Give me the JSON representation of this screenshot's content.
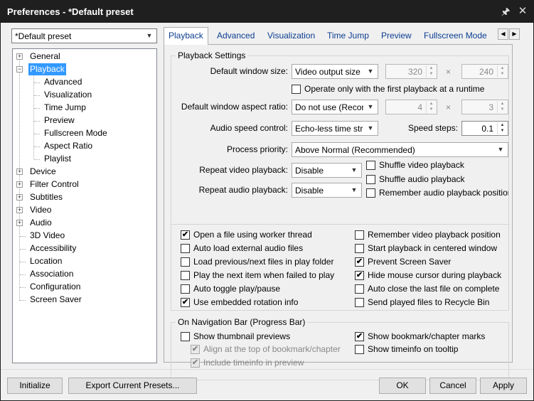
{
  "window": {
    "title": "Preferences - *Default preset",
    "pin_icon": "pin-icon",
    "close_icon": "close-icon"
  },
  "preset_select": {
    "value": "*Default preset"
  },
  "tree": {
    "items": [
      {
        "label": "General"
      },
      {
        "label": "Playback"
      },
      {
        "label": "Advanced"
      },
      {
        "label": "Visualization"
      },
      {
        "label": "Time Jump"
      },
      {
        "label": "Preview"
      },
      {
        "label": "Fullscreen Mode"
      },
      {
        "label": "Aspect Ratio"
      },
      {
        "label": "Playlist"
      },
      {
        "label": "Device"
      },
      {
        "label": "Filter Control"
      },
      {
        "label": "Subtitles"
      },
      {
        "label": "Video"
      },
      {
        "label": "Audio"
      },
      {
        "label": "3D Video"
      },
      {
        "label": "Accessibility"
      },
      {
        "label": "Location"
      },
      {
        "label": "Association"
      },
      {
        "label": "Configuration"
      },
      {
        "label": "Screen Saver"
      }
    ],
    "selected": "Playback"
  },
  "tabs": [
    {
      "label": "Playback"
    },
    {
      "label": "Advanced"
    },
    {
      "label": "Visualization"
    },
    {
      "label": "Time Jump"
    },
    {
      "label": "Preview"
    },
    {
      "label": "Fullscreen Mode"
    }
  ],
  "playback_settings": {
    "title": "Playback Settings",
    "window_size": {
      "label": "Default window size:",
      "value": "Video output size",
      "width": "320",
      "height": "240"
    },
    "first_playback": {
      "label": "Operate only with the first playback at a runtime",
      "checked": false
    },
    "aspect_ratio": {
      "label": "Default window aspect ratio:",
      "value": "Do not use (Recom",
      "w": "4",
      "h": "3"
    },
    "audio_speed": {
      "label": "Audio speed control:",
      "value": "Echo-less time stre",
      "steps_label": "Speed steps:",
      "steps": "0.1"
    },
    "priority": {
      "label": "Process priority:",
      "value": "Above Normal (Recommended)"
    },
    "repeat_video": {
      "label": "Repeat video playback:",
      "value": "Disable"
    },
    "repeat_audio": {
      "label": "Repeat audio playback:",
      "value": "Disable"
    },
    "shuffle_video": {
      "label": "Shuffle video playback",
      "checked": false
    },
    "shuffle_audio": {
      "label": "Shuffle audio playback",
      "checked": false
    },
    "remember_audio": {
      "label": "Remember audio playback position",
      "checked": false
    },
    "times": "×"
  },
  "options_left": [
    {
      "label": "Open a file using worker thread",
      "checked": true
    },
    {
      "label": "Auto load external audio files",
      "checked": false
    },
    {
      "label": "Load previous/next files in play folder",
      "checked": false
    },
    {
      "label": "Play the next item when failed to play",
      "checked": false
    },
    {
      "label": "Auto toggle play/pause",
      "checked": false
    },
    {
      "label": "Use embedded rotation info",
      "checked": true
    }
  ],
  "options_right": [
    {
      "label": "Remember video playback position",
      "checked": false
    },
    {
      "label": "Start playback in centered window",
      "checked": false
    },
    {
      "label": "Prevent Screen Saver",
      "checked": true
    },
    {
      "label": "Hide mouse cursor during playback",
      "checked": true
    },
    {
      "label": "Auto close the last file on complete",
      "checked": false
    },
    {
      "label": "Send played files to Recycle Bin",
      "checked": false
    }
  ],
  "nav_bar": {
    "title": "On Navigation Bar (Progress Bar)",
    "thumbnail": {
      "label": "Show thumbnail previews",
      "checked": false
    },
    "align_top": {
      "label": "Align at the top of bookmark/chapter",
      "checked": true
    },
    "include_time": {
      "label": "Include timeinfo in preview",
      "checked": true
    },
    "bookmark": {
      "label": "Show bookmark/chapter marks",
      "checked": true
    },
    "timeinfo": {
      "label": "Show timeinfo on tooltip",
      "checked": false
    }
  },
  "buttons": {
    "initialize": "Initialize",
    "export": "Export Current Presets...",
    "ok": "OK",
    "cancel": "Cancel",
    "apply": "Apply"
  },
  "check_glyph": "✔"
}
